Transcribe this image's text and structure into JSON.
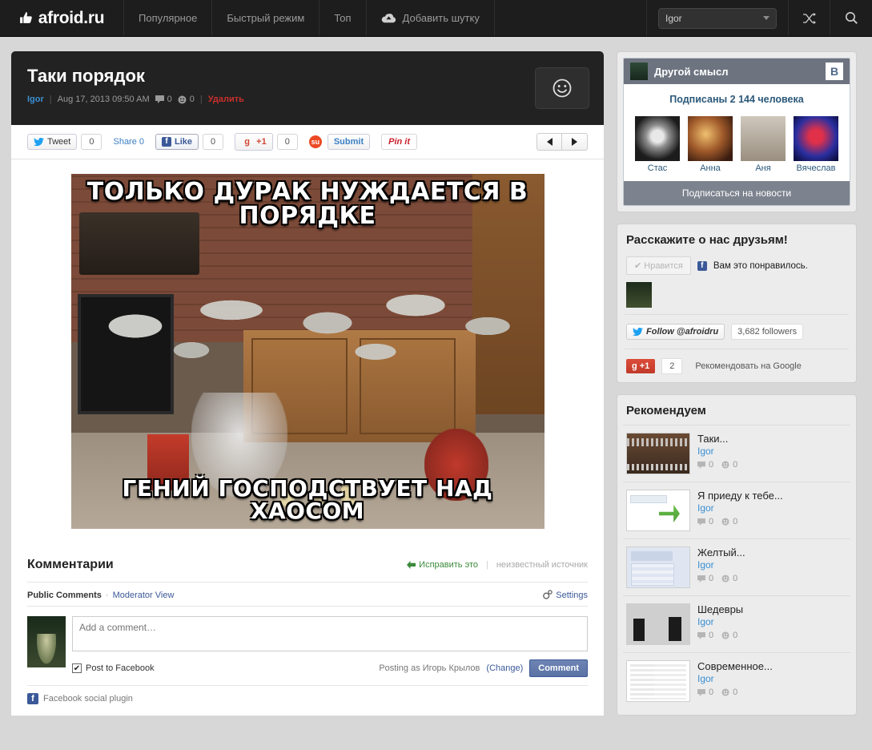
{
  "topbar": {
    "logo": "afroid.ru",
    "logo_icon": "thumbs-up-icon",
    "nav": [
      {
        "label": "Популярное"
      },
      {
        "label": "Быстрый режим"
      },
      {
        "label": "Топ"
      },
      {
        "label": "Добавить шутку",
        "icon": "upload-cloud-icon"
      }
    ],
    "user_select": "Igor",
    "random_icon": "shuffle-icon",
    "search_icon": "search-icon"
  },
  "post": {
    "title": "Таки порядок",
    "author": "Igor",
    "date": "Aug 17, 2013 09:50 AM",
    "comment_count": "0",
    "smiley_count": "0",
    "delete_label": "Удалить",
    "reaction_button_icon": "smiley-icon",
    "prev_label": "◀",
    "next_label": "▶",
    "image": {
      "top_text": "ТОЛЬКО ДУРАК НУЖДАЕТСЯ В ПОРЯДКЕ",
      "bottom_text": "ГЕНИЙ ГОСПОДСТВУЕТ НАД ХАОСОМ"
    }
  },
  "share": {
    "tweet_label": "Tweet",
    "tweet_count": "0",
    "share_label": "Share 0",
    "like_label": "Like",
    "like_count": "0",
    "gplus_label": "+1",
    "gplus_count": "0",
    "stumble_label": "Submit",
    "pin_label": "Pin it"
  },
  "comments": {
    "title": "Комментарии",
    "fix_label": "Исправить это",
    "source_label": "неизвестный источник",
    "fb": {
      "tab_public": "Public Comments",
      "tab_moderator": "Moderator View",
      "settings_label": "Settings",
      "placeholder": "Add a comment…",
      "post_to_facebook": "Post to Facebook",
      "posting_as": "Posting as Игорь Крылов",
      "change_label": "(Change)",
      "comment_button": "Comment",
      "plugin_label": "Facebook social plugin"
    }
  },
  "sidebar": {
    "vk": {
      "title": "Другой смысл",
      "badge": "В",
      "subscribers_text": "Подписаны 2 144 человека",
      "users": [
        {
          "name": "Стас"
        },
        {
          "name": "Анна"
        },
        {
          "name": "Аня"
        },
        {
          "name": "Вячеслав"
        }
      ],
      "subscribe_button": "Подписаться на новости"
    },
    "social": {
      "title": "Расскажите о нас друзьям!",
      "fb_like_label": "✔ Нравится",
      "fb_liked_text": "Вам это понравилось.",
      "twitter_follow": "Follow @afroidru",
      "twitter_followers": "3,682 followers",
      "gplus_label": "+1",
      "gplus_count": "2",
      "gplus_recommend": "Рекомендовать на Google"
    },
    "recommend": {
      "title": "Рекомендуем",
      "items": [
        {
          "title": "Таки...",
          "author": "Igor",
          "comments": "0",
          "smiles": "0",
          "thumb": "t1"
        },
        {
          "title": "Я приеду к тебе...",
          "author": "Igor",
          "comments": "0",
          "smiles": "0",
          "thumb": "t2"
        },
        {
          "title": "Желтый...",
          "author": "Igor",
          "comments": "0",
          "smiles": "0",
          "thumb": "t3"
        },
        {
          "title": "Шедевры",
          "author": "Igor",
          "comments": "0",
          "smiles": "0",
          "thumb": "t4"
        },
        {
          "title": "Современное...",
          "author": "Igor",
          "comments": "0",
          "smiles": "0",
          "thumb": "t5"
        }
      ]
    }
  }
}
